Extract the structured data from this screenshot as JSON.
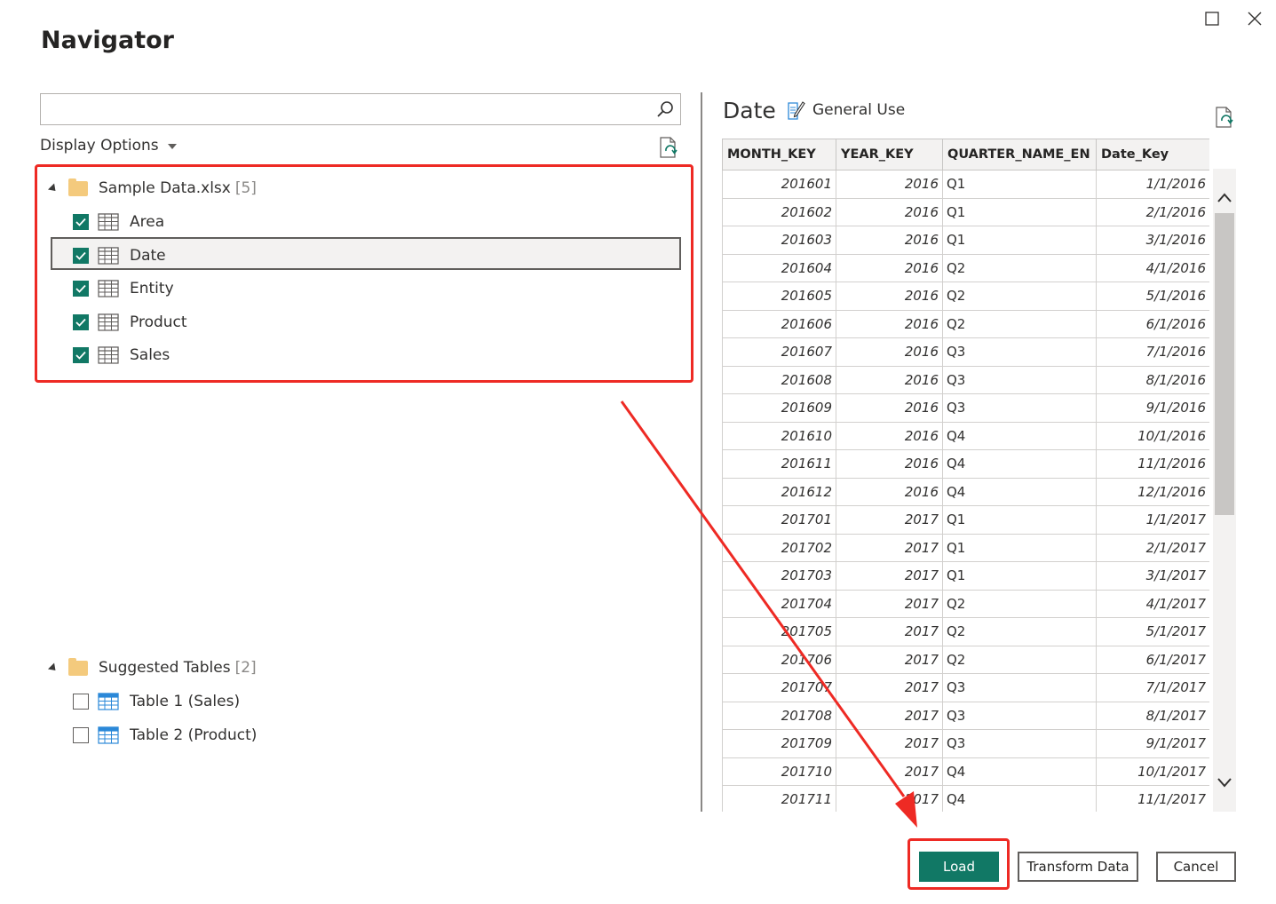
{
  "window": {
    "title": "Navigator",
    "maximize_icon": "square-icon",
    "close_icon": "x-icon"
  },
  "search": {
    "value": "",
    "placeholder": ""
  },
  "display_options_label": "Display Options",
  "tree": {
    "source": {
      "name": "Sample Data.xlsx",
      "count": "[5]"
    },
    "items": [
      {
        "label": "Area",
        "checked": true
      },
      {
        "label": "Date",
        "checked": true
      },
      {
        "label": "Entity",
        "checked": true
      },
      {
        "label": "Product",
        "checked": true
      },
      {
        "label": "Sales",
        "checked": true
      }
    ],
    "suggested": {
      "name": "Suggested Tables",
      "count": "[2]"
    },
    "suggested_items": [
      {
        "label": "Table 1 (Sales)",
        "checked": false
      },
      {
        "label": "Table 2 (Product)",
        "checked": false
      }
    ]
  },
  "preview": {
    "title": "Date",
    "general_use": "General Use",
    "columns": [
      "MONTH_KEY",
      "YEAR_KEY",
      "QUARTER_NAME_EN",
      "Date_Key"
    ],
    "rows": [
      [
        "201601",
        "2016",
        "Q1",
        "1/1/2016"
      ],
      [
        "201602",
        "2016",
        "Q1",
        "2/1/2016"
      ],
      [
        "201603",
        "2016",
        "Q1",
        "3/1/2016"
      ],
      [
        "201604",
        "2016",
        "Q2",
        "4/1/2016"
      ],
      [
        "201605",
        "2016",
        "Q2",
        "5/1/2016"
      ],
      [
        "201606",
        "2016",
        "Q2",
        "6/1/2016"
      ],
      [
        "201607",
        "2016",
        "Q3",
        "7/1/2016"
      ],
      [
        "201608",
        "2016",
        "Q3",
        "8/1/2016"
      ],
      [
        "201609",
        "2016",
        "Q3",
        "9/1/2016"
      ],
      [
        "201610",
        "2016",
        "Q4",
        "10/1/2016"
      ],
      [
        "201611",
        "2016",
        "Q4",
        "11/1/2016"
      ],
      [
        "201612",
        "2016",
        "Q4",
        "12/1/2016"
      ],
      [
        "201701",
        "2017",
        "Q1",
        "1/1/2017"
      ],
      [
        "201702",
        "2017",
        "Q1",
        "2/1/2017"
      ],
      [
        "201703",
        "2017",
        "Q1",
        "3/1/2017"
      ],
      [
        "201704",
        "2017",
        "Q2",
        "4/1/2017"
      ],
      [
        "201705",
        "2017",
        "Q2",
        "5/1/2017"
      ],
      [
        "201706",
        "2017",
        "Q2",
        "6/1/2017"
      ],
      [
        "201707",
        "2017",
        "Q3",
        "7/1/2017"
      ],
      [
        "201708",
        "2017",
        "Q3",
        "8/1/2017"
      ],
      [
        "201709",
        "2017",
        "Q3",
        "9/1/2017"
      ],
      [
        "201710",
        "2017",
        "Q4",
        "10/1/2017"
      ],
      [
        "201711",
        "2017",
        "Q4",
        "11/1/2017"
      ]
    ]
  },
  "buttons": {
    "load": "Load",
    "transform": "Transform Data",
    "cancel": "Cancel"
  },
  "colors": {
    "accent": "#117865",
    "annotation": "#ee2a24",
    "selected_row_bg": "#f3f2f1"
  }
}
